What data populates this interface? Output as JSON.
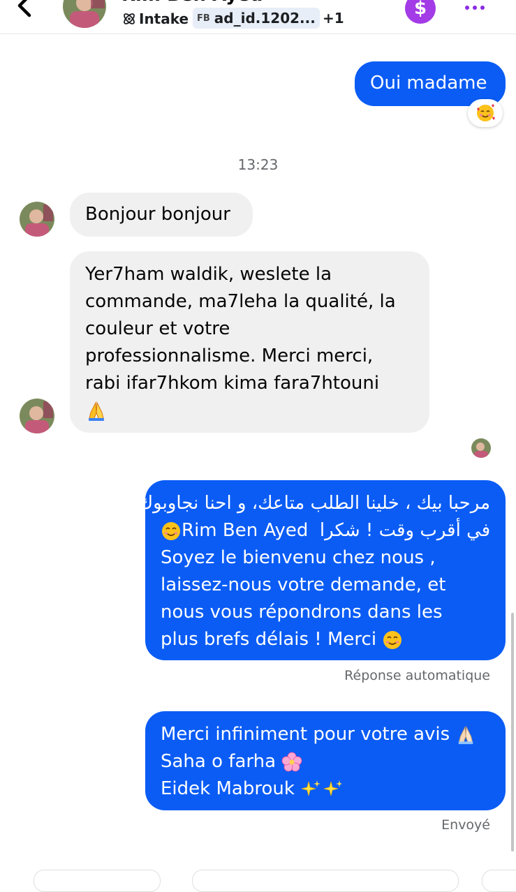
{
  "header": {
    "contact_name": "Rim Ben Ayed",
    "tag_intake": "Intake",
    "tag_source": "FB",
    "tag_ad": "ad_id.1202...",
    "tag_more": "+1",
    "dollar_symbol": "$"
  },
  "messages": {
    "m1": {
      "text": "Oui madame",
      "reaction": "smiling-face-with-hearts"
    },
    "timestamp": "13:23",
    "m2": {
      "text": "Bonjour bonjour"
    },
    "m3": {
      "lines": [
        "Yer7ham waldik, weslete la",
        "commande, ma7leha la qualité, la",
        "couleur et votre",
        "professionnalisme. Merci merci,",
        "rabi ifar7hkom kima fara7htouni"
      ],
      "emoji": "🙏"
    },
    "m4": {
      "line1": "مرحبا بيك ، خلينا الطلب متاعك، و احنا نجاوبوك",
      "line2_ar": "في أقرب وقت ! شكرا",
      "line2_name": "Rim Ben Ayed",
      "lines": [
        "Soyez le bienvenu chez nous ,",
        "laissez-nous votre demande, et",
        "nous vous répondrons dans les",
        "plus brefs délais ! Merci"
      ],
      "status": "Réponse automatique"
    },
    "m5": {
      "lines": [
        "Merci infiniment pour votre avis",
        "Saha o farha",
        "Eidek Mabrouk"
      ],
      "status": "Envoyé"
    }
  },
  "colors": {
    "outgoing_bubble": "#0a5cf5",
    "incoming_bubble": "#f0f0f0",
    "accent_purple": "#a33be6"
  }
}
